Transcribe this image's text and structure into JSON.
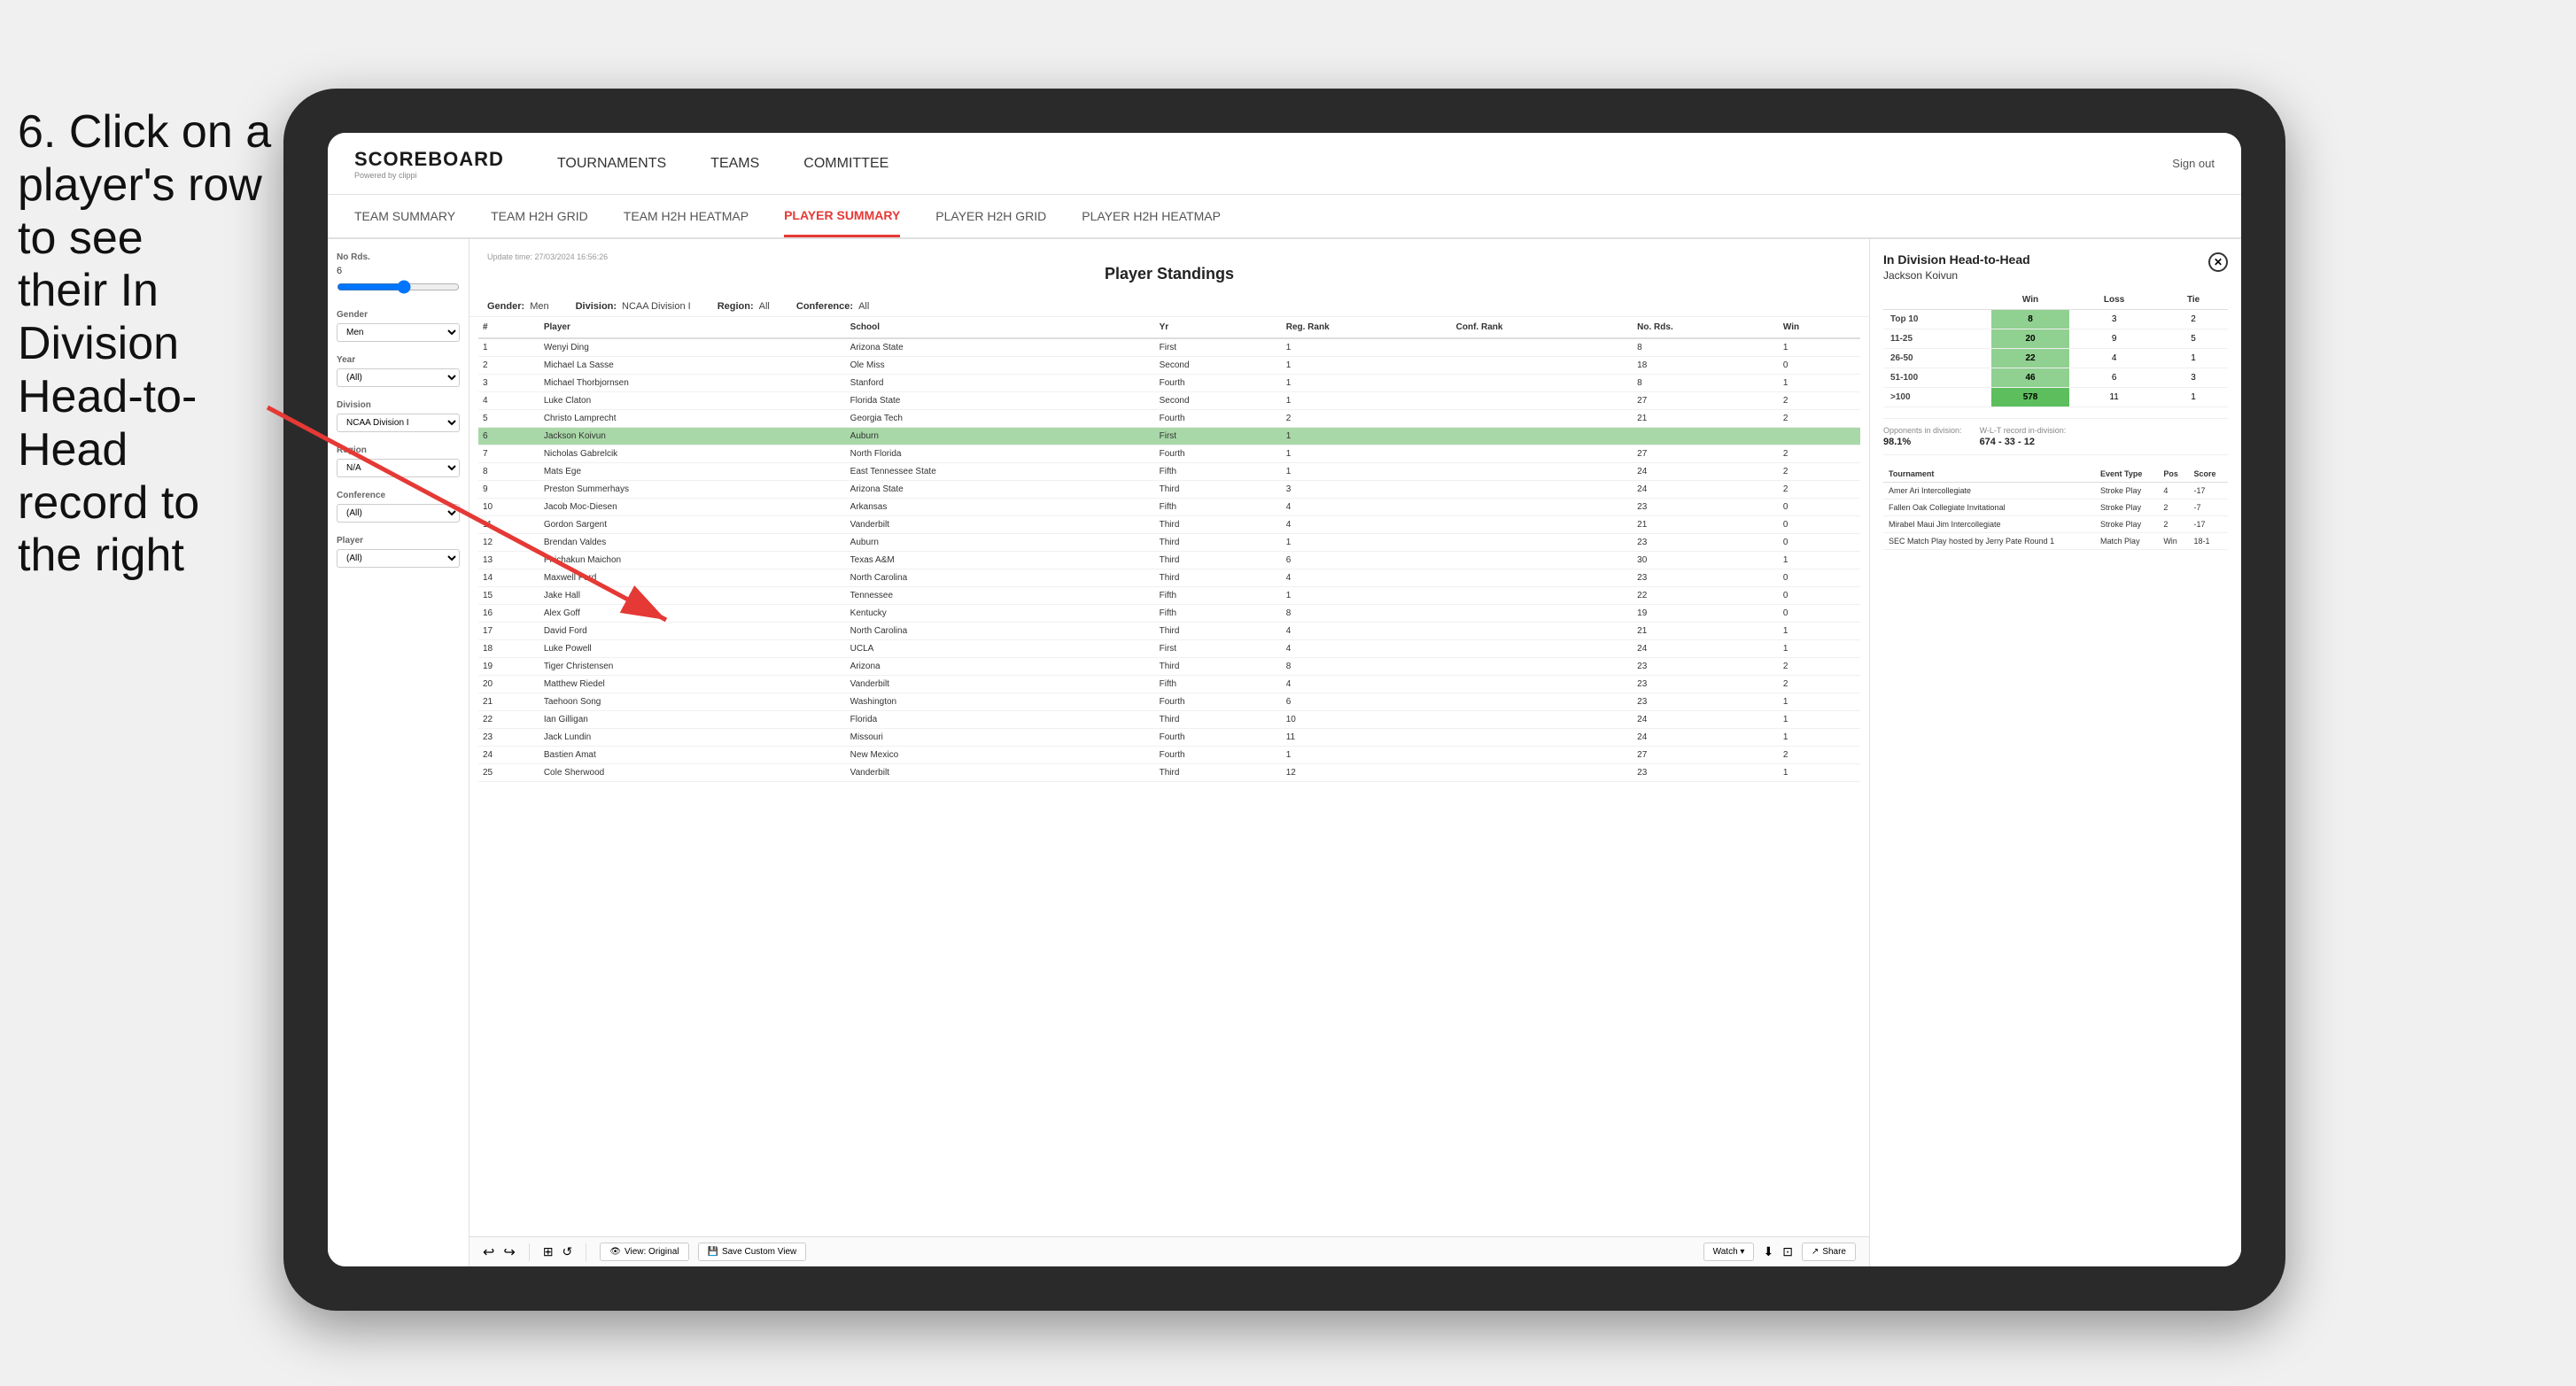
{
  "instruction": {
    "line1": "6. Click on a",
    "line2": "player's row to see",
    "line3": "their In Division",
    "line4": "Head-to-Head",
    "line5": "record to the right"
  },
  "nav": {
    "logo_main": "SCOREBOARD",
    "logo_sub": "Powered by clippi",
    "items": [
      "TOURNAMENTS",
      "TEAMS",
      "COMMITTEE"
    ],
    "sign_out": "Sign out"
  },
  "sub_nav": {
    "items": [
      "TEAM SUMMARY",
      "TEAM H2H GRID",
      "TEAM H2H HEATMAP",
      "PLAYER SUMMARY",
      "PLAYER H2H GRID",
      "PLAYER H2H HEATMAP"
    ],
    "active": "PLAYER SUMMARY"
  },
  "sidebar": {
    "no_rds": {
      "label": "No Rds.",
      "value": "6"
    },
    "gender": {
      "label": "Gender",
      "value": "Men"
    },
    "year": {
      "label": "Year",
      "value": "(All)"
    },
    "division": {
      "label": "Division",
      "value": "NCAA Division I"
    },
    "region": {
      "label": "Region",
      "value": "N/A"
    },
    "conference": {
      "label": "Conference",
      "value": "(All)"
    },
    "player": {
      "label": "Player",
      "value": "(All)"
    }
  },
  "panel": {
    "update_time": "Update time:",
    "update_date": "27/03/2024 16:56:26",
    "title": "Player Standings",
    "filters": {
      "gender": {
        "label": "Gender:",
        "value": "Men"
      },
      "division": {
        "label": "Division:",
        "value": "NCAA Division I"
      },
      "region": {
        "label": "Region:",
        "value": "All"
      },
      "conference": {
        "label": "Conference:",
        "value": "All"
      }
    }
  },
  "table": {
    "headers": [
      "#",
      "Player",
      "School",
      "Yr",
      "Reg. Rank",
      "Conf. Rank",
      "No. Rds.",
      "Win"
    ],
    "rows": [
      {
        "rank": 1,
        "player": "Wenyi Ding",
        "school": "Arizona State",
        "yr": "First",
        "reg_rank": 1,
        "conf_rank": "",
        "no_rds": 8,
        "win": 1
      },
      {
        "rank": 2,
        "player": "Michael La Sasse",
        "school": "Ole Miss",
        "yr": "Second",
        "reg_rank": 1,
        "conf_rank": "",
        "no_rds": 18,
        "win": 0
      },
      {
        "rank": 3,
        "player": "Michael Thorbjornsen",
        "school": "Stanford",
        "yr": "Fourth",
        "reg_rank": 1,
        "conf_rank": "",
        "no_rds": 8,
        "win": 1
      },
      {
        "rank": 4,
        "player": "Luke Claton",
        "school": "Florida State",
        "yr": "Second",
        "reg_rank": 1,
        "conf_rank": "",
        "no_rds": 27,
        "win": 2
      },
      {
        "rank": 5,
        "player": "Christo Lamprecht",
        "school": "Georgia Tech",
        "yr": "Fourth",
        "reg_rank": 2,
        "conf_rank": "",
        "no_rds": 21,
        "win": 2
      },
      {
        "rank": 6,
        "player": "Jackson Koivun",
        "school": "Auburn",
        "yr": "First",
        "reg_rank": 1,
        "conf_rank": "",
        "no_rds": "",
        "win": ""
      },
      {
        "rank": 7,
        "player": "Nicholas Gabrelcik",
        "school": "North Florida",
        "yr": "Fourth",
        "reg_rank": 1,
        "conf_rank": "",
        "no_rds": 27,
        "win": 2
      },
      {
        "rank": 8,
        "player": "Mats Ege",
        "school": "East Tennessee State",
        "yr": "Fifth",
        "reg_rank": 1,
        "conf_rank": "",
        "no_rds": 24,
        "win": 2
      },
      {
        "rank": 9,
        "player": "Preston Summerhays",
        "school": "Arizona State",
        "yr": "Third",
        "reg_rank": 3,
        "conf_rank": "",
        "no_rds": 24,
        "win": 2
      },
      {
        "rank": 10,
        "player": "Jacob Moc-Diesen",
        "school": "Arkansas",
        "yr": "Fifth",
        "reg_rank": 4,
        "conf_rank": "",
        "no_rds": 23,
        "win": 0
      },
      {
        "rank": 11,
        "player": "Gordon Sargent",
        "school": "Vanderbilt",
        "yr": "Third",
        "reg_rank": 4,
        "conf_rank": "",
        "no_rds": 21,
        "win": 0
      },
      {
        "rank": 12,
        "player": "Brendan Valdes",
        "school": "Auburn",
        "yr": "Third",
        "reg_rank": 1,
        "conf_rank": "",
        "no_rds": 23,
        "win": 0
      },
      {
        "rank": 13,
        "player": "Phichakun Maichon",
        "school": "Texas A&M",
        "yr": "Third",
        "reg_rank": 6,
        "conf_rank": "",
        "no_rds": 30,
        "win": 1
      },
      {
        "rank": 14,
        "player": "Maxwell Ford",
        "school": "North Carolina",
        "yr": "Third",
        "reg_rank": 4,
        "conf_rank": "",
        "no_rds": 23,
        "win": 0
      },
      {
        "rank": 15,
        "player": "Jake Hall",
        "school": "Tennessee",
        "yr": "Fifth",
        "reg_rank": 1,
        "conf_rank": "",
        "no_rds": 22,
        "win": 0
      },
      {
        "rank": 16,
        "player": "Alex Goff",
        "school": "Kentucky",
        "yr": "Fifth",
        "reg_rank": 8,
        "conf_rank": "",
        "no_rds": 19,
        "win": 0
      },
      {
        "rank": 17,
        "player": "David Ford",
        "school": "North Carolina",
        "yr": "Third",
        "reg_rank": 4,
        "conf_rank": "",
        "no_rds": 21,
        "win": 1
      },
      {
        "rank": 18,
        "player": "Luke Powell",
        "school": "UCLA",
        "yr": "First",
        "reg_rank": 4,
        "conf_rank": "",
        "no_rds": 24,
        "win": 1
      },
      {
        "rank": 19,
        "player": "Tiger Christensen",
        "school": "Arizona",
        "yr": "Third",
        "reg_rank": 8,
        "conf_rank": "",
        "no_rds": 23,
        "win": 2
      },
      {
        "rank": 20,
        "player": "Matthew Riedel",
        "school": "Vanderbilt",
        "yr": "Fifth",
        "reg_rank": 4,
        "conf_rank": "",
        "no_rds": 23,
        "win": 2
      },
      {
        "rank": 21,
        "player": "Taehoon Song",
        "school": "Washington",
        "yr": "Fourth",
        "reg_rank": 6,
        "conf_rank": "",
        "no_rds": 23,
        "win": 1
      },
      {
        "rank": 22,
        "player": "Ian Gilligan",
        "school": "Florida",
        "yr": "Third",
        "reg_rank": 10,
        "conf_rank": "",
        "no_rds": 24,
        "win": 1
      },
      {
        "rank": 23,
        "player": "Jack Lundin",
        "school": "Missouri",
        "yr": "Fourth",
        "reg_rank": 11,
        "conf_rank": "",
        "no_rds": 24,
        "win": 1
      },
      {
        "rank": 24,
        "player": "Bastien Amat",
        "school": "New Mexico",
        "yr": "Fourth",
        "reg_rank": 1,
        "conf_rank": "",
        "no_rds": 27,
        "win": 2
      },
      {
        "rank": 25,
        "player": "Cole Sherwood",
        "school": "Vanderbilt",
        "yr": "Third",
        "reg_rank": 12,
        "conf_rank": "",
        "no_rds": 23,
        "win": 1
      }
    ]
  },
  "h2h": {
    "title": "In Division Head-to-Head",
    "player": "Jackson Koivun",
    "table_headers": [
      "",
      "Win",
      "Loss",
      "Tie"
    ],
    "rows": [
      {
        "rank": "Top 10",
        "win": 8,
        "loss": 3,
        "tie": 2,
        "highlight": false
      },
      {
        "rank": "11-25",
        "win": 20,
        "loss": 9,
        "tie": 5,
        "highlight": false
      },
      {
        "rank": "26-50",
        "win": 22,
        "loss": 4,
        "tie": 1,
        "highlight": false
      },
      {
        "rank": "51-100",
        "win": 46,
        "loss": 6,
        "tie": 3,
        "highlight": false
      },
      {
        "rank": ">100",
        "win": 578,
        "loss": 11,
        "tie": 1,
        "highlight": true
      }
    ],
    "opponents_label": "Opponents in division:",
    "opponents_value": "98.1%",
    "wlt_label": "W-L-T record in-division:",
    "wlt_value": "674 - 33 - 12",
    "tournament_headers": [
      "Tournament",
      "Event Type",
      "Pos",
      "Score"
    ],
    "tournaments": [
      {
        "name": "Amer Ari Intercollegiate",
        "type": "Stroke Play",
        "pos": 4,
        "score": "-17"
      },
      {
        "name": "Fallen Oak Collegiate Invitational",
        "type": "Stroke Play",
        "pos": 2,
        "score": "-7"
      },
      {
        "name": "Mirabel Maui Jim Intercollegiate",
        "type": "Stroke Play",
        "pos": 2,
        "score": "-17"
      },
      {
        "name": "SEC Match Play hosted by Jerry Pate Round 1",
        "type": "Match Play",
        "pos": "Win",
        "score": "18-1"
      }
    ]
  },
  "toolbar": {
    "view_original": "View: Original",
    "save_custom": "Save Custom View",
    "watch": "Watch ▾",
    "share": "Share"
  }
}
